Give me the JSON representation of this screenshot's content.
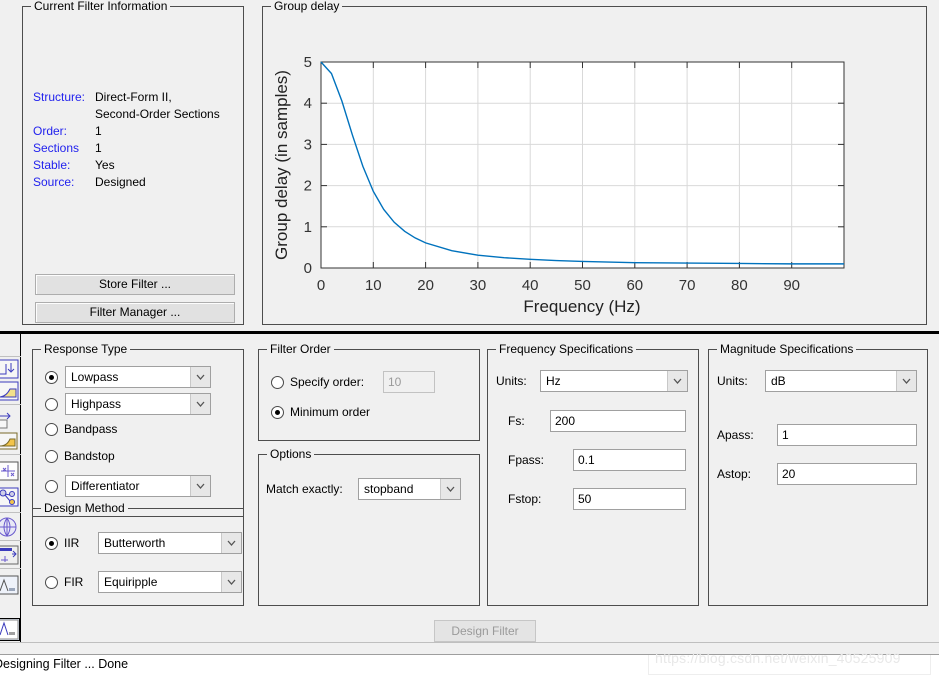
{
  "filter_info": {
    "title": "Current Filter Information",
    "rows": [
      {
        "label": "Structure:",
        "value": "Direct-Form II,",
        "value2": "Second-Order Sections"
      },
      {
        "label": "Order:",
        "value": "1"
      },
      {
        "label": "Sections",
        "value": "1"
      },
      {
        "label": "Stable:",
        "value": "Yes"
      },
      {
        "label": "Source:",
        "value": "Designed"
      }
    ],
    "store_filter_label": "Store Filter ...",
    "filter_manager_label": "Filter Manager ..."
  },
  "plot": {
    "title": "Group delay"
  },
  "chart_data": {
    "type": "line",
    "title": "Group delay",
    "xlabel": "Frequency (Hz)",
    "ylabel": "Group delay (in samples)",
    "xlim": [
      0,
      100
    ],
    "ylim": [
      0,
      5
    ],
    "xticks": [
      0,
      10,
      20,
      30,
      40,
      50,
      60,
      70,
      80,
      90
    ],
    "yticks": [
      0,
      1,
      2,
      3,
      4,
      5
    ],
    "grid": true,
    "legend": null,
    "line_color": "#0072bd",
    "series": [
      {
        "name": "Group delay",
        "x": [
          0,
          2,
          4,
          6,
          8,
          10,
          12,
          14,
          16,
          18,
          20,
          25,
          30,
          35,
          40,
          45,
          50,
          60,
          70,
          80,
          90,
          100
        ],
        "y": [
          5.0,
          4.72,
          4.05,
          3.23,
          2.47,
          1.86,
          1.42,
          1.11,
          0.89,
          0.73,
          0.61,
          0.42,
          0.31,
          0.25,
          0.21,
          0.18,
          0.16,
          0.13,
          0.12,
          0.11,
          0.1,
          0.1
        ]
      }
    ]
  },
  "response_type": {
    "title": "Response Type",
    "options": [
      {
        "type": "combo",
        "label": "Lowpass",
        "selected": true
      },
      {
        "type": "combo",
        "label": "Highpass",
        "selected": false
      },
      {
        "type": "radio",
        "label": "Bandpass",
        "selected": false
      },
      {
        "type": "radio",
        "label": "Bandstop",
        "selected": false
      },
      {
        "type": "combo",
        "label": "Differentiator",
        "selected": false
      }
    ]
  },
  "design_method": {
    "title": "Design Method",
    "options": [
      {
        "label": "IIR",
        "value": "Butterworth",
        "selected": true
      },
      {
        "label": "FIR",
        "value": "Equiripple",
        "selected": false
      }
    ]
  },
  "filter_order": {
    "title": "Filter Order",
    "specify_label": "Specify order:",
    "specify_value": "10",
    "specify_selected": false,
    "minimum_label": "Minimum order",
    "minimum_selected": true
  },
  "options": {
    "title": "Options",
    "match_label": "Match exactly:",
    "match_value": "stopband"
  },
  "frequency_spec": {
    "title": "Frequency Specifications",
    "units_label": "Units:",
    "units_value": "Hz",
    "fields": [
      {
        "label": "Fs:",
        "value": "200"
      },
      {
        "label": "Fpass:",
        "value": "0.1"
      },
      {
        "label": "Fstop:",
        "value": "50"
      }
    ]
  },
  "magnitude_spec": {
    "title": "Magnitude Specifications",
    "units_label": "Units:",
    "units_value": "dB",
    "fields": [
      {
        "label": "Apass:",
        "value": "1"
      },
      {
        "label": "Astop:",
        "value": "20"
      }
    ]
  },
  "footer": {
    "design_filter_label": "Design Filter",
    "status_text": "Designing Filter ... Done",
    "watermark": "https://blog.csdn.net/weixin_40525909"
  }
}
